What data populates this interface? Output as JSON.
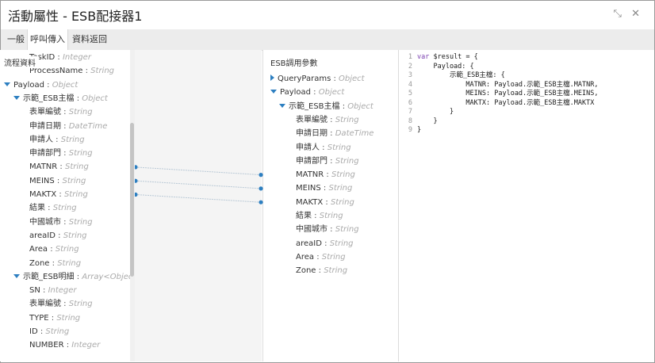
{
  "window": {
    "title": "活動屬性 - ESB配接器1",
    "controls": {
      "restore": "⤡",
      "close": "✕"
    }
  },
  "tabs": [
    {
      "label": "一般"
    },
    {
      "label": "呼叫傳入"
    },
    {
      "label": "資料返回"
    }
  ],
  "left": {
    "title": "流程資料",
    "rows": [
      {
        "name": "TaskID",
        "type": "Integer"
      },
      {
        "name": "ProcessName",
        "type": "String"
      },
      {
        "name": "Payload",
        "type": "Object",
        "caret": "down"
      },
      {
        "name": "示範_ESB主檔",
        "type": "Object",
        "caret": "down"
      },
      {
        "name": "表單編號",
        "type": "String"
      },
      {
        "name": "申請日期",
        "type": "DateTime"
      },
      {
        "name": "申請人",
        "type": "String"
      },
      {
        "name": "申請部門",
        "type": "String"
      },
      {
        "name": "MATNR",
        "type": "String"
      },
      {
        "name": "MEINS",
        "type": "String"
      },
      {
        "name": "MAKTX",
        "type": "String"
      },
      {
        "name": "結果",
        "type": "String"
      },
      {
        "name": "中國城市",
        "type": "String"
      },
      {
        "name": "areaID",
        "type": "String"
      },
      {
        "name": "Area",
        "type": "String"
      },
      {
        "name": "Zone",
        "type": "String"
      },
      {
        "name": "示範_ESB明細",
        "type": "Array<Object>",
        "caret": "down"
      },
      {
        "name": "SN",
        "type": "Integer"
      },
      {
        "name": "表單編號",
        "type": "String"
      },
      {
        "name": "TYPE",
        "type": "String"
      },
      {
        "name": "ID",
        "type": "String"
      },
      {
        "name": "NUMBER",
        "type": "Integer"
      }
    ]
  },
  "right": {
    "title": "ESB調用參數",
    "rows": [
      {
        "name": "QueryParams",
        "type": "Object",
        "caret": "right"
      },
      {
        "name": "Payload",
        "type": "Object",
        "caret": "down"
      },
      {
        "name": "示範_ESB主檔",
        "type": "Object",
        "caret": "down"
      },
      {
        "name": "表單編號",
        "type": "String"
      },
      {
        "name": "申請日期",
        "type": "DateTime"
      },
      {
        "name": "申請人",
        "type": "String"
      },
      {
        "name": "申請部門",
        "type": "String"
      },
      {
        "name": "MATNR",
        "type": "String"
      },
      {
        "name": "MEINS",
        "type": "String"
      },
      {
        "name": "MAKTX",
        "type": "String"
      },
      {
        "name": "結果",
        "type": "String"
      },
      {
        "name": "中國城市",
        "type": "String"
      },
      {
        "name": "areaID",
        "type": "String"
      },
      {
        "name": "Area",
        "type": "String"
      },
      {
        "name": "Zone",
        "type": "String"
      }
    ]
  },
  "mappings": [
    {
      "from": "MATNR",
      "to": "MATNR"
    },
    {
      "from": "MEINS",
      "to": "MEINS"
    },
    {
      "from": "MAKTX",
      "to": "MAKTX"
    }
  ],
  "code": [
    {
      "n": "1",
      "text": "var $result = {"
    },
    {
      "n": "2",
      "text": "    Payload: {"
    },
    {
      "n": "3",
      "text": "        示範_ESB主檔: {"
    },
    {
      "n": "4",
      "text": "            MATNR: Payload.示範_ESB主檔.MATNR,"
    },
    {
      "n": "5",
      "text": "            MEINS: Payload.示範_ESB主檔.MEINS,"
    },
    {
      "n": "6",
      "text": "            MAKTX: Payload.示範_ESB主檔.MAKTX"
    },
    {
      "n": "7",
      "text": "        }"
    },
    {
      "n": "8",
      "text": "    }"
    },
    {
      "n": "9",
      "text": "}"
    }
  ],
  "colors": {
    "accent": "#2d7fc1",
    "connector": "#b9c9d6"
  }
}
